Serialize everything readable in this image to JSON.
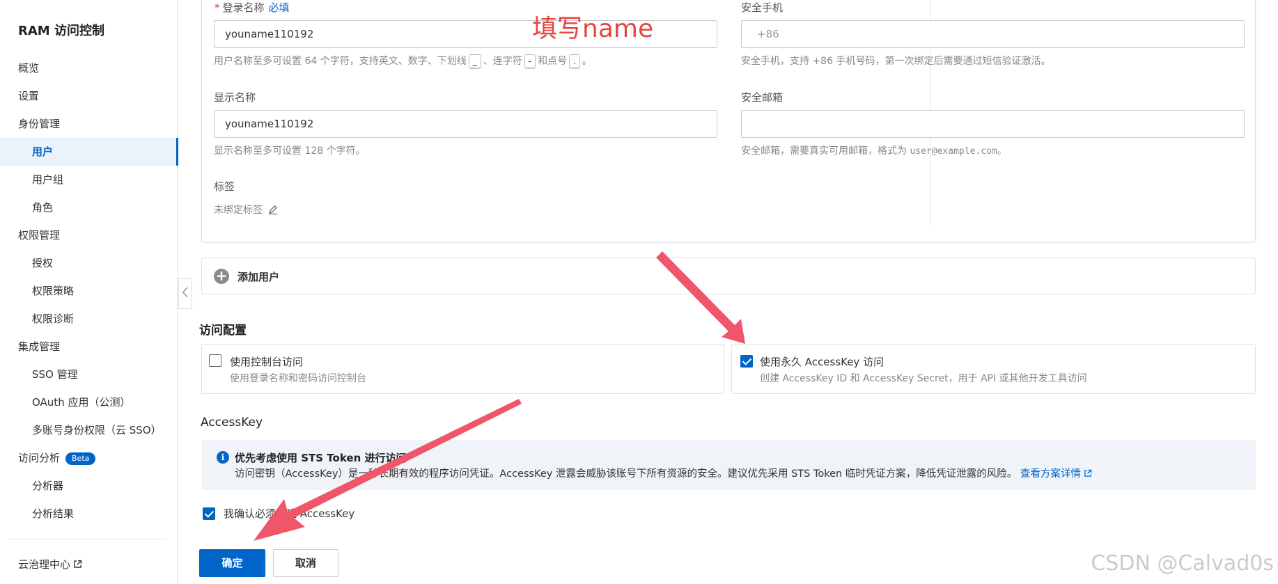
{
  "sidebar": {
    "title": "RAM 访问控制",
    "items": [
      {
        "label": "概览"
      },
      {
        "label": "设置"
      },
      {
        "label": "身份管理"
      },
      {
        "label": "用户"
      },
      {
        "label": "用户组"
      },
      {
        "label": "角色"
      },
      {
        "label": "权限管理"
      },
      {
        "label": "授权"
      },
      {
        "label": "权限策略"
      },
      {
        "label": "权限诊断"
      },
      {
        "label": "集成管理"
      },
      {
        "label": "SSO 管理"
      },
      {
        "label": "OAuth 应用（公测）"
      },
      {
        "label": "多账号身份权限（云 SSO）"
      },
      {
        "label": "访问分析",
        "badge": "Beta"
      },
      {
        "label": "分析器"
      },
      {
        "label": "分析结果"
      }
    ],
    "footer": "云治理中心"
  },
  "form": {
    "login_name": {
      "label": "登录名称",
      "required_mark": "*",
      "required_text": "必填",
      "value": "youname110192",
      "help_prefix": "用户名称至多可设置 64 个字符，支持英文、数字、下划线",
      "help_k1": "_",
      "help_sep1": "、连字符",
      "help_k2": "-",
      "help_sep2": "和点号",
      "help_k3": ".",
      "help_end": "。"
    },
    "display_name": {
      "label": "显示名称",
      "value": "youname110192",
      "help": "显示名称至多可设置 128 个字符。"
    },
    "tags": {
      "label": "标签",
      "value": "未绑定标签"
    },
    "phone": {
      "label": "安全手机",
      "placeholder": "+86",
      "help": "安全手机，支持 +86 手机号码，第一次绑定后需要通过短信验证激活。"
    },
    "email": {
      "label": "安全邮箱",
      "value": "",
      "help_prefix": "安全邮箱，需要真实可用邮箱，格式为",
      "help_example": "user@example.com",
      "help_end": "。"
    }
  },
  "annotation": {
    "text": "填写name"
  },
  "add_user": {
    "label": "添加用户"
  },
  "access_config": {
    "title": "访问配置",
    "console": {
      "title": "使用控制台访问",
      "desc": "使用登录名称和密码访问控制台",
      "checked": false
    },
    "accesskey": {
      "title": "使用永久 AccessKey 访问",
      "desc": "创建 AccessKey ID 和 AccessKey Secret，用于 API 或其他开发工具访问",
      "checked": true
    }
  },
  "accesskey_section": {
    "title": "AccessKey",
    "info_title": "优先考虑使用 STS Token 进行访问",
    "info_body": "访问密钥（AccessKey）是一种长期有效的程序访问凭证。AccessKey 泄露会威胁该账号下所有资源的安全。建议优先采用 STS Token 临时凭证方案，降低凭证泄露的风险。",
    "info_link": "查看方案详情",
    "confirm_label": "我确认必须创建 AccessKey",
    "confirm_checked": true
  },
  "buttons": {
    "ok": "确定",
    "cancel": "取消"
  },
  "watermark": "CSDN @Calvad0s",
  "colors": {
    "primary": "#0064c8",
    "annotation": "#e8443e",
    "arrow": "#f0566a"
  }
}
